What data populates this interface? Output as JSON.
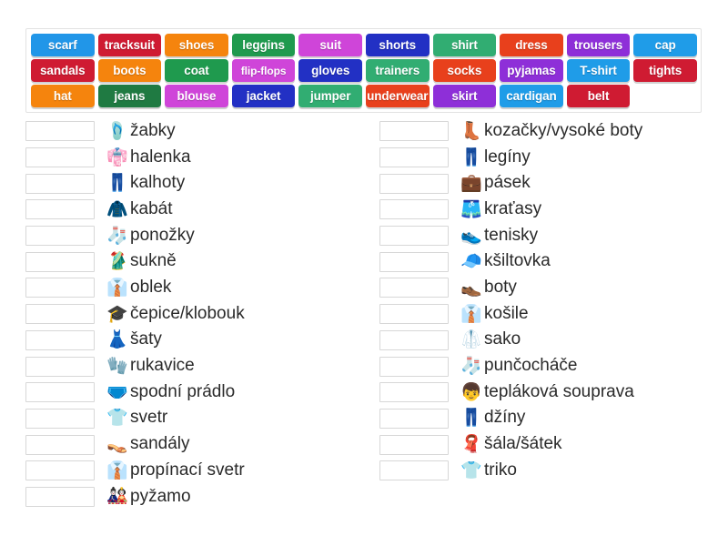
{
  "wordbank": {
    "rows": [
      [
        {
          "label": "scarf",
          "color": "#2196e8"
        },
        {
          "label": "tracksuit",
          "color": "#cf1b32"
        },
        {
          "label": "shoes",
          "color": "#f5840d"
        },
        {
          "label": "leggins",
          "color": "#1f9a4e"
        },
        {
          "label": "suit",
          "color": "#cf45d9"
        },
        {
          "label": "shorts",
          "color": "#2230c4"
        },
        {
          "label": "shirt",
          "color": "#31ad72"
        },
        {
          "label": "dress",
          "color": "#e8401c"
        },
        {
          "label": "trousers",
          "color": "#8e2fd8"
        },
        {
          "label": "cap",
          "color": "#1f9ce8"
        }
      ],
      [
        {
          "label": "sandals",
          "color": "#cf1b32"
        },
        {
          "label": "boots",
          "color": "#f5840d"
        },
        {
          "label": "coat",
          "color": "#1f9a4e"
        },
        {
          "label": "flip-flops",
          "color": "#cf45d9"
        },
        {
          "label": "gloves",
          "color": "#2230c4"
        },
        {
          "label": "trainers",
          "color": "#31ad72"
        },
        {
          "label": "socks",
          "color": "#e8401c"
        },
        {
          "label": "pyjamas",
          "color": "#8e2fd8"
        },
        {
          "label": "T-shirt",
          "color": "#1f9ce8"
        },
        {
          "label": "tights",
          "color": "#cf1b32"
        }
      ],
      [
        {
          "label": "hat",
          "color": "#f5840d"
        },
        {
          "label": "jeans",
          "color": "#1f7a42"
        },
        {
          "label": "blouse",
          "color": "#cf45d9"
        },
        {
          "label": "jacket",
          "color": "#2230c4"
        },
        {
          "label": "jumper",
          "color": "#31ad72"
        },
        {
          "label": "underwear",
          "color": "#e8401c"
        },
        {
          "label": "skirt",
          "color": "#8e2fd8"
        },
        {
          "label": "cardigan",
          "color": "#1f9ce8"
        },
        {
          "label": "belt",
          "color": "#cf1b32"
        },
        {
          "label": "",
          "color": "transparent"
        }
      ]
    ]
  },
  "lists": {
    "left": [
      {
        "icon": "flip-flop-icon",
        "glyph": "🩴",
        "label": "žabky"
      },
      {
        "icon": "blouse-icon",
        "glyph": "👘",
        "label": "halenka"
      },
      {
        "icon": "trousers-icon",
        "glyph": "👖",
        "label": "kalhoty"
      },
      {
        "icon": "coat-icon",
        "glyph": "🧥",
        "label": "kabát"
      },
      {
        "icon": "socks-icon",
        "glyph": "🧦",
        "label": "ponožky"
      },
      {
        "icon": "skirt-icon",
        "glyph": "🥻",
        "label": "sukně"
      },
      {
        "icon": "suit-icon",
        "glyph": "👔",
        "label": "oblek"
      },
      {
        "icon": "hat-icon",
        "glyph": "🎓",
        "label": "čepice/klobouk"
      },
      {
        "icon": "dress-icon",
        "glyph": "👗",
        "label": "šaty"
      },
      {
        "icon": "gloves-icon",
        "glyph": "🧤",
        "label": "rukavice"
      },
      {
        "icon": "underwear-icon",
        "glyph": "🩲",
        "label": "spodní prádlo"
      },
      {
        "icon": "jumper-icon",
        "glyph": "👕",
        "label": "svetr"
      },
      {
        "icon": "sandal-icon",
        "glyph": "👡",
        "label": "sandály"
      },
      {
        "icon": "cardigan-icon",
        "glyph": "👔",
        "label": "propínací svetr"
      },
      {
        "icon": "pyjamas-icon",
        "glyph": "🎎",
        "label": "pyžamo"
      }
    ],
    "right": [
      {
        "icon": "boot-icon",
        "glyph": "👢",
        "label": "kozačky/vysoké boty"
      },
      {
        "icon": "leggings-icon",
        "glyph": "👖",
        "label": "legíny"
      },
      {
        "icon": "belt-icon",
        "glyph": "💼",
        "label": "pásek"
      },
      {
        "icon": "shorts-icon",
        "glyph": "🩳",
        "label": "kraťasy"
      },
      {
        "icon": "trainers-icon",
        "glyph": "👟",
        "label": "tenisky"
      },
      {
        "icon": "cap-icon",
        "glyph": "🧢",
        "label": "kšiltovka"
      },
      {
        "icon": "shoe-icon",
        "glyph": "👞",
        "label": "boty"
      },
      {
        "icon": "shirt-icon",
        "glyph": "👔",
        "label": "košile"
      },
      {
        "icon": "jacket-icon",
        "glyph": "🥼",
        "label": "sako"
      },
      {
        "icon": "tights-icon",
        "glyph": "🧦",
        "label": "punčocháče"
      },
      {
        "icon": "tracksuit-icon",
        "glyph": "👦",
        "label": "tepláková souprava"
      },
      {
        "icon": "jeans-icon",
        "glyph": "👖",
        "label": "džíny"
      },
      {
        "icon": "scarf-icon",
        "glyph": "🧣",
        "label": "šála/šátek"
      },
      {
        "icon": "tshirt-icon",
        "glyph": "👕",
        "label": "triko"
      }
    ]
  }
}
